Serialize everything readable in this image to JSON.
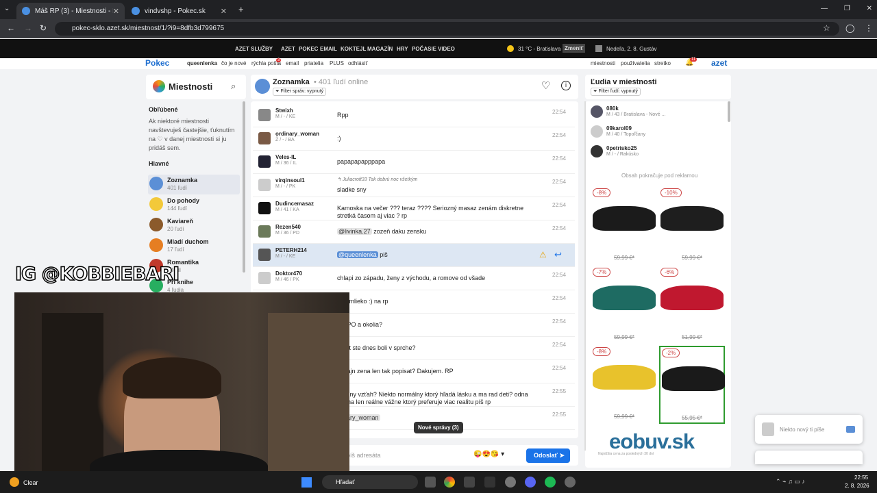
{
  "browser": {
    "tabs": [
      {
        "title": "Máš RP (3) - Miestnosti - Pokec"
      },
      {
        "title": "vindvshp - Pokec.sk"
      }
    ],
    "url": "pokec-sklo.azet.sk/miestnost/1/?i9=8dfb3d799675",
    "new_tab": "+"
  },
  "azet_bar": {
    "menu": "AZET SLUŽBY",
    "links": [
      "AZET",
      "POKEC",
      "EMAIL",
      "KOKTEJL",
      "MAGAZÍN",
      "HRY",
      "POČASIE",
      "VIDEO"
    ],
    "weather": "31 °C - Bratislava",
    "change": "Zmeniť",
    "date": "Nedeľa, 2. 8. Gustáv"
  },
  "pokec_nav": {
    "logo": "Pokec",
    "user": "queenlenka",
    "links": [
      "čo je nové",
      "rýchla pošta",
      "email",
      "priatelia",
      "PLUS",
      "odhlásiť"
    ],
    "badge": "3",
    "right_links": [
      "miestnosti",
      "používatelia",
      "stretko"
    ],
    "notif_badge": "11",
    "brand": "azet"
  },
  "left": {
    "title": "Miestnosti",
    "fav_title": "Obľúbené",
    "fav_text": "Ak niektoré miestnosti navštevuješ častejšie, ťuknutím na ♡ v danej miestnosti si ju pridáš sem.",
    "main_title": "Hlavné",
    "rooms": [
      {
        "name": "Zoznamka",
        "count": "401 ľudí"
      },
      {
        "name": "Do pohody",
        "count": "144 ľudí"
      },
      {
        "name": "Kaviareň",
        "count": "20 ľudí"
      },
      {
        "name": "Mladí duchom",
        "count": "17 ľudí"
      },
      {
        "name": "Romantika",
        "count": "5 ľudí"
      },
      {
        "name": "Pri knihe",
        "count": "4 ľudia"
      }
    ]
  },
  "chat": {
    "room": "Zoznamka",
    "online": "• 401 ľudí online",
    "filter": "Filter správ: vypnutý",
    "messages": [
      {
        "user": "Stwixh",
        "info": "M / - / KE",
        "text": "Rpp",
        "time": "22:54"
      },
      {
        "user": "ordinary_woman",
        "info": "Ž / - / BA",
        "text": ":)",
        "time": "22:54"
      },
      {
        "user": "Veles-IL",
        "info": "M / 36 / IL",
        "text": "papapapapppapa",
        "time": "22:54"
      },
      {
        "user": "virqinsoul1",
        "info": "M / - / PK",
        "reply": "Juliacroft33  Tak dobrú noc všetkým",
        "text": "sladke sny",
        "time": "22:54"
      },
      {
        "user": "Dudincemasaz",
        "info": "M / 41 / KA",
        "text": "Kamoska na večer ??? teraz ???? Seriozný masaz zenám diskretne stretká časom aj viac ? rp",
        "time": "22:54"
      },
      {
        "user": "Rezen540",
        "info": "M / 36 / PD",
        "mention": "@livinka.27",
        "text": "zozeň daku zensku",
        "time": "22:54"
      },
      {
        "user": "PETERH214",
        "info": "M / - / KE",
        "mention": "@queenlenka",
        "text": "piš",
        "time": ""
      },
      {
        "user": "Doktor470",
        "info": "M / 46 / PK",
        "text": "chlapi zo západu, ženy z východu, a romove od všade",
        "time": "22:54"
      },
      {
        "user": "",
        "info": "",
        "text": "rv a mlieko :) na rp",
        "time": "22:54"
      },
      {
        "user": "",
        "info": "",
        "text": "a z PO a okolia?",
        "time": "22:54"
      },
      {
        "user": "",
        "info": "",
        "text": "okrát ste dnes boli v sprche?",
        "time": "22:54"
      },
      {
        "user": "",
        "info": "",
        "text": "ka fajn zena len tak popisat? Dakujem. RP",
        "time": "22:54"
      },
      {
        "user": "",
        "info": "",
        "text": "i vážny vzťah? Niekto normálny ktorý hľadá lásku a ma rad deti? odna mama len reálne vážne ktorý preferuje viac realitu píš rp",
        "time": "22:55"
      },
      {
        "user": "",
        "info": "",
        "mention": "dinary_woman",
        "text": "",
        "time": "22:55"
      }
    ],
    "new_messages": "Nové správy (3)",
    "input_placeholder": "píš adresáta",
    "send": "Odoslať"
  },
  "right": {
    "title": "Ľudia v miestnosti",
    "filter": "Filter ľudí: vypnutý",
    "users": [
      {
        "name": "080k",
        "info": "M / 43 / Bratislava - Nové ..."
      },
      {
        "name": "09karol09",
        "info": "M / 40 / Topoľčany"
      },
      {
        "name": "0petrisko25",
        "info": "M / - / Rakúsko"
      }
    ],
    "ad_note": "Obsah pokračuje pod reklamou",
    "shoes": [
      {
        "disc": "-8%",
        "price": "59,99 €*",
        "color": "#1b1b1b"
      },
      {
        "disc": "-10%",
        "price": "59,99 €*",
        "color": "#1e1e1e"
      },
      {
        "disc": "-7%",
        "price": "59,99 €*",
        "color": "#1e6b62"
      },
      {
        "disc": "-6%",
        "price": "51,99 €*",
        "color": "#c0182f"
      },
      {
        "disc": "-8%",
        "price": "59,99 €*",
        "color": "#e8c22c"
      },
      {
        "disc": "-2%",
        "price": "55,95 €*",
        "color": "#1a1a1a"
      }
    ],
    "brand": "eobuv.sk",
    "brand_note": "Najnižšia cena za posledných 30 dní"
  },
  "notification": {
    "text": "Niekto nový ti píše"
  },
  "overlay": {
    "handle": "IG @KOBBIEBARI"
  },
  "taskbar": {
    "weather": "Clear",
    "search": "Hľadať",
    "time": "22:55",
    "date": "2. 8. 2026"
  },
  "colors": {
    "accent": "#1a73e8",
    "pokec_blue": "#1565c0",
    "eobuv": "#2a6f9a"
  }
}
